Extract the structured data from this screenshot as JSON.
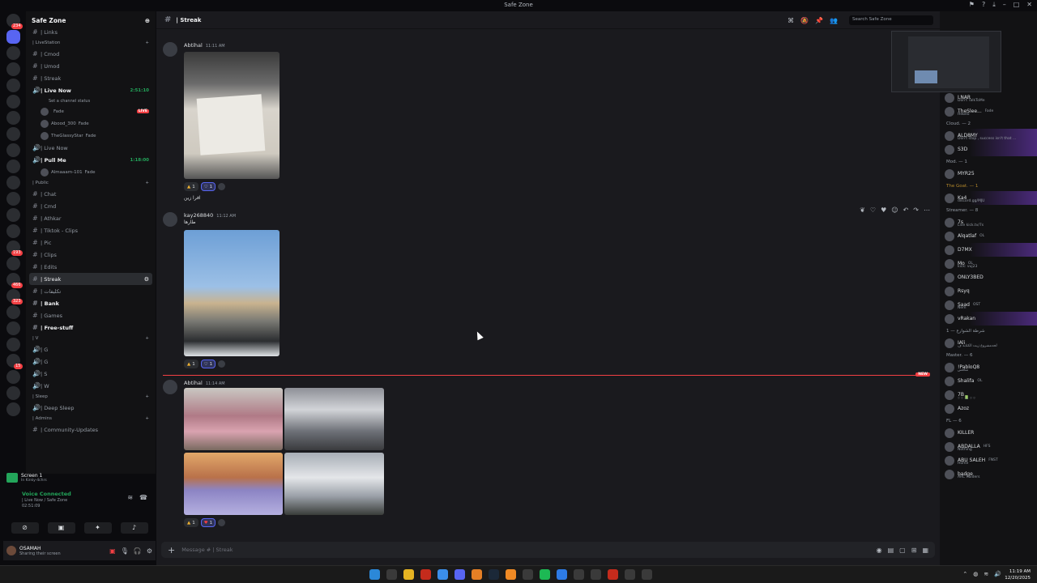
{
  "window": {
    "title": "Safe Zone"
  },
  "server": {
    "name": "Safe Zone"
  },
  "server_badges": [
    "234",
    "193",
    "466",
    "323",
    "15"
  ],
  "channels": {
    "top": [
      {
        "name": "| Links"
      }
    ],
    "livestation_cat": "| LiveStation",
    "livestation": [
      {
        "name": "| Cmod"
      },
      {
        "name": "| Umod"
      },
      {
        "name": "| Streak"
      }
    ],
    "live_now": {
      "name": "| Live Now",
      "time": "2:51:10",
      "status": "Set a channel status",
      "live_badge": "LIVE",
      "users": [
        {
          "name": "Fade",
          "prefix": ""
        },
        {
          "name": "Fade",
          "prefix": "Abood_300"
        },
        {
          "name": "Fade",
          "prefix": "TheGlassyStar"
        }
      ]
    },
    "live_now2": {
      "name": "| Live Now"
    },
    "pull_me": {
      "name": "| Pull Me",
      "time": "1:18:00",
      "user": "Almaaam-101",
      "user_tag": "Fade"
    },
    "public_cat": "| Public",
    "public": [
      {
        "name": "| Chat"
      },
      {
        "name": "| Cmd"
      },
      {
        "name": "| Athkar"
      },
      {
        "name": "| Tiktok - Clips"
      },
      {
        "name": "| Pic"
      },
      {
        "name": "| Clips"
      },
      {
        "name": "| Edits"
      }
    ],
    "selected": {
      "name": "| Streak"
    },
    "after": [
      {
        "name": "| تكليفات"
      },
      {
        "name": "| Bank",
        "bold": true
      },
      {
        "name": "| Games"
      },
      {
        "name": "| Free-stuff",
        "bold": true
      }
    ],
    "v_cat": "| V",
    "voice": [
      {
        "name": "| G"
      },
      {
        "name": "| G"
      },
      {
        "name": "| S"
      },
      {
        "name": "| W"
      }
    ],
    "sleep_cat": "| Sleep",
    "sleep": [
      {
        "name": "| Deep Sleep"
      }
    ],
    "admins_cat": "| Admins",
    "admins": [
      {
        "name": "| Community-Updates"
      }
    ]
  },
  "screen_share": {
    "title": "Screen 1",
    "sub": "In Kinky-4chrs"
  },
  "voice_panel": {
    "status": "Voice Connected",
    "channel": "| Live Now / Safe Zone",
    "ping": "02:51:09"
  },
  "user": {
    "name": "OSAMAH",
    "status": "Sharing their screen"
  },
  "channel_header": {
    "name": "| Streak",
    "search_placeholder": "Search Safe Zone"
  },
  "messages": [
    {
      "author": "Abtihal",
      "time": "11:11 AM",
      "text": "افرا زين",
      "reactions": [
        {
          "emoji": "▲",
          "count": "1"
        },
        {
          "emoji": "♡",
          "count": "1"
        }
      ]
    },
    {
      "author": "kay268840",
      "time": "11:12 AM",
      "text": "طارها",
      "reactions": [
        {
          "emoji": "▲",
          "count": "1"
        },
        {
          "emoji": "♡",
          "count": "1"
        }
      ]
    },
    {
      "author": "Abtihal",
      "time": "11:14 AM",
      "text": "",
      "reactions": [
        {
          "emoji": "▲",
          "count": "1"
        },
        {
          "emoji": "♥",
          "count": "1"
        }
      ]
    }
  ],
  "new_marker": "NEW",
  "composer": {
    "placeholder": "Message # | Streak"
  },
  "members": {
    "top": [
      {
        "name": "LNAR",
        "status": "Don't TalkToMe"
      },
      {
        "name": "TheSlee...",
        "tag": "Fade",
        "status": "Hebeo"
      }
    ],
    "cloud_cat": "Cloud. — 2",
    "cloud": [
      {
        "name": "ALD8MY",
        "status": "Don't stop , success isn't that ...",
        "hl": true
      },
      {
        "name": "S3D",
        "hl": true
      }
    ],
    "mod_cat": "Mod. — 1",
    "mod": [
      {
        "name": "MYR25"
      }
    ],
    "goat_cat": "The Goat. — 1",
    "goat": [
      {
        "name": "Ka4",
        "status": "discord.gg/MJU",
        "hl": true
      }
    ],
    "streamer_cat": "Streamer. — 8",
    "streamer": [
      {
        "name": "7s",
        "status": "Live kick.tv/7s"
      },
      {
        "name": "Alqatlaf",
        "tag": "OL"
      },
      {
        "name": "D7MX",
        "hl": true
      },
      {
        "name": "Mo",
        "tag": "OL",
        "status": "kick: vuj23"
      },
      {
        "name": "ONLY3BED"
      },
      {
        "name": "Rsyq"
      },
      {
        "name": "Saad",
        "tag": "OST",
        "status": "Nem"
      },
      {
        "name": "vRakan",
        "hl": true
      }
    ],
    "arabic_cat": "شرطة الشوارع — 1",
    "arabic": [
      {
        "name": "IAli",
        "status": "لحدمشروع زيت الكتابة ف"
      }
    ],
    "master_cat": "Master. — 6",
    "master": [
      {
        "name": "!PabloQ8",
        "status": "منافس"
      },
      {
        "name": "Shalifa",
        "tag": "OL"
      },
      {
        "name": "7B",
        "status": "۞ ۞ 📗 ۞ ۞"
      },
      {
        "name": "Azoz"
      }
    ],
    "fl_cat": "FL — 6",
    "fl": [
      {
        "name": "KILLER"
      },
      {
        "name": "ABDALLA",
        "tag": "HFS",
        "status": "Nothing"
      },
      {
        "name": "ABU SALEH",
        "tag": "FNST",
        "status": "Home"
      },
      {
        "name": "badge",
        "status": "ARC Raiders"
      }
    ]
  },
  "taskbar": {
    "time": "11:19 AM",
    "date": "12/20/2025"
  },
  "colors": {
    "accent": "#5865f2",
    "online": "#23a55a",
    "danger": "#f23f43",
    "bg": "#1a1a1e"
  }
}
